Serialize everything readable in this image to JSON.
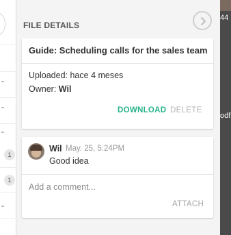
{
  "background": {
    "badges": [
      "1",
      "1"
    ],
    "right_text_top": "44",
    "right_text_mid": "odf"
  },
  "panel": {
    "title": "FILE DETAILS",
    "close_icon": "chevron-right-circle-icon"
  },
  "file": {
    "name": "Guide: Scheduling calls for the sales team",
    "uploaded_label": "Uploaded:",
    "uploaded_value": "hace 4 meses",
    "owner_label": "Owner:",
    "owner_value": "Wil",
    "download_label": "DOWNLOAD",
    "delete_label": "DELETE"
  },
  "comments": {
    "items": [
      {
        "author": "Wil",
        "timestamp": "May. 25, 5:24PM",
        "text": "Good idea"
      }
    ],
    "input_placeholder": "Add a comment...",
    "attach_label": "ATTACH"
  },
  "colors": {
    "accent": "#26b38a",
    "muted": "#b3b3b3",
    "panel_bg": "#f4f4f4"
  }
}
